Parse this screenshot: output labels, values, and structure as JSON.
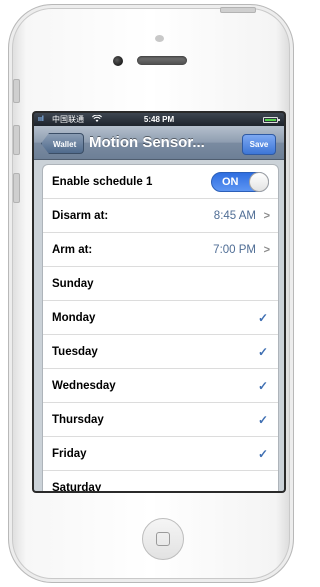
{
  "status_bar": {
    "signal": "ııl",
    "carrier": "中国联通",
    "wifi_icon": "wifi-icon",
    "time": "5:48 PM",
    "battery_icon": "battery-icon"
  },
  "nav": {
    "back_label": "Wallet",
    "title": "Motion Sensor...",
    "save_label": "Save"
  },
  "schedule": {
    "enable_label": "Enable schedule 1",
    "toggle_state": "ON",
    "disarm_label": "Disarm at:",
    "disarm_value": "8:45 AM",
    "arm_label": "Arm at:",
    "arm_value": "7:00 PM"
  },
  "days": [
    {
      "label": "Sunday",
      "checked": false
    },
    {
      "label": "Monday",
      "checked": true
    },
    {
      "label": "Tuesday",
      "checked": true
    },
    {
      "label": "Wednesday",
      "checked": true
    },
    {
      "label": "Thursday",
      "checked": true
    },
    {
      "label": "Friday",
      "checked": true
    },
    {
      "label": "Saturday",
      "checked": false
    }
  ],
  "colors": {
    "nav_bar": "#7a8ba1",
    "toggle_on": "#2f6ee0",
    "value_text": "#4f6d95",
    "checkmark": "#3f6fb2",
    "save_button": "#3d76d6"
  }
}
